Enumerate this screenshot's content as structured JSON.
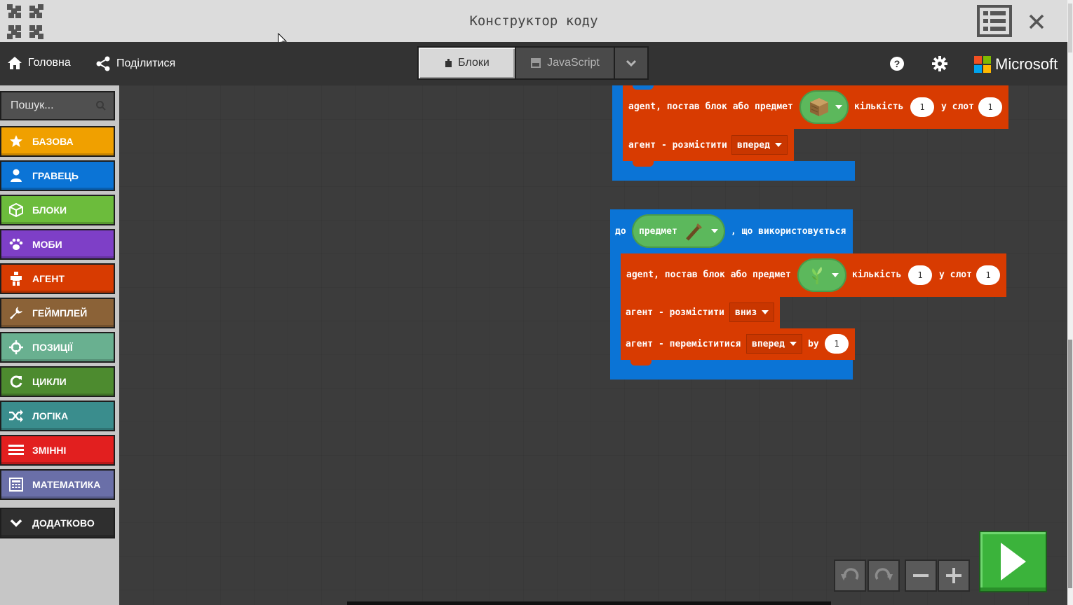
{
  "window": {
    "title": "Конструктор коду"
  },
  "menu": {
    "home_label": "Головна",
    "share_label": "Поділитися",
    "tabs": {
      "blocks": "Блоки",
      "javascript": "JavaScript"
    },
    "brand": "Microsoft"
  },
  "toolbox": {
    "search_placeholder": "Пошук...",
    "categories": [
      {
        "label": "БАЗОВА",
        "color": "#f0a000",
        "icon": "star-icon"
      },
      {
        "label": "ГРАВЕЦЬ",
        "color": "#0b74d6",
        "icon": "person-icon"
      },
      {
        "label": "БЛОКИ",
        "color": "#6cbc3c",
        "icon": "cube-icon"
      },
      {
        "label": "МОБИ",
        "color": "#7e3fc7",
        "icon": "paw-icon"
      },
      {
        "label": "АГЕНТ",
        "color": "#d83b01",
        "icon": "agent-icon"
      },
      {
        "label": "ГЕЙМПЛЕЙ",
        "color": "#8b6237",
        "icon": "wrench-icon"
      },
      {
        "label": "ПОЗИЦІЇ",
        "color": "#69b090",
        "icon": "crosshair-icon"
      },
      {
        "label": "ЦИКЛИ",
        "color": "#4d8b2f",
        "icon": "loop-icon"
      },
      {
        "label": "ЛОГІКА",
        "color": "#3a8d8d",
        "icon": "shuffle-icon"
      },
      {
        "label": "ЗМІННІ",
        "color": "#e21f1f",
        "icon": "list-icon"
      },
      {
        "label": "МАТЕМАТИКА",
        "color": "#6a6fa8",
        "icon": "calculator-icon"
      }
    ],
    "advanced_label": "ДОДАТКОВО"
  },
  "workspace": {
    "group1": {
      "place_text": "agent, постав блок або предмет",
      "amount_label": "кількість",
      "amount_value": "1",
      "slot_label": "у слот",
      "slot_value": "1",
      "place_dir_text": "агент - розмістити",
      "place_dir_value": "вперед",
      "item_icon": "oak-planks-icon"
    },
    "group2": {
      "event_prefix": "до",
      "event_item_label": "предмет",
      "event_suffix": ", що використовується",
      "event_item_icon": "stick-icon",
      "place_text": "agent, постав блок або предмет",
      "amount_label": "кількість",
      "amount_value": "1",
      "slot_label": "у слот",
      "slot_value": "1",
      "item_icon": "sapling-icon",
      "place_dir_text": "агент - розмістити",
      "place_dir_value": "вниз",
      "move_text": "агент - переміститися",
      "move_dir_value": "вперед",
      "move_by_label": "by",
      "move_by_value": "1"
    }
  },
  "colors": {
    "loop_blue": "#0b74d6",
    "agent_orange": "#d83b01",
    "run_green": "#3bb33b"
  }
}
